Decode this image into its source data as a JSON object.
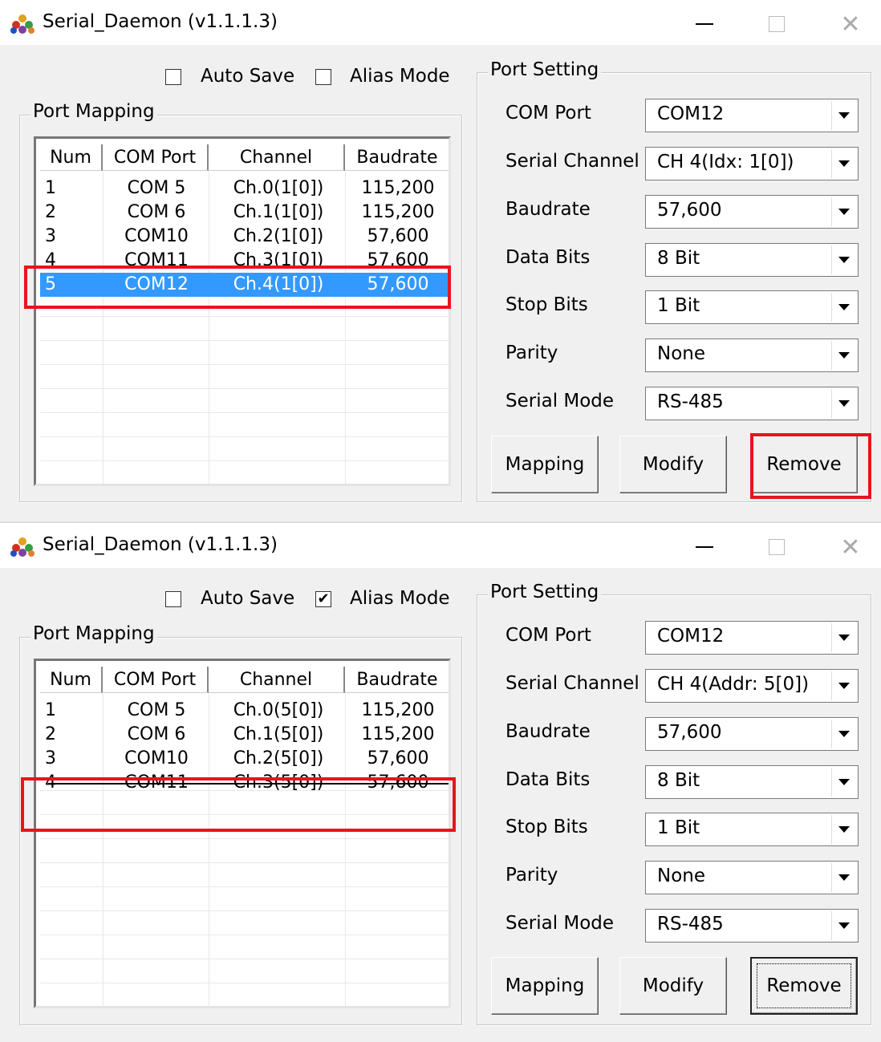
{
  "windows": [
    {
      "title": "Serial_Daemon (v1.1.1.3)",
      "auto_save": {
        "label": "Auto Save",
        "checked": false
      },
      "alias_mode": {
        "label": "Alias Mode",
        "checked": false
      },
      "port_mapping": {
        "title": "Port Mapping",
        "columns": [
          "Num",
          "COM Port",
          "Channel",
          "Baudrate"
        ],
        "rows": [
          {
            "num": "1",
            "com": "COM 5",
            "channel": "Ch.0(1[0])",
            "baud": "115,200"
          },
          {
            "num": "2",
            "com": "COM 6",
            "channel": "Ch.1(1[0])",
            "baud": "115,200"
          },
          {
            "num": "3",
            "com": "COM10",
            "channel": "Ch.2(1[0])",
            "baud": "57,600"
          },
          {
            "num": "4",
            "com": "COM11",
            "channel": "Ch.3(1[0])",
            "baud": "57,600"
          },
          {
            "num": "5",
            "com": "COM12",
            "channel": "Ch.4(1[0])",
            "baud": "57,600"
          }
        ]
      },
      "port_setting": {
        "title": "Port Setting",
        "fields": [
          {
            "label": "COM Port",
            "value": "COM12"
          },
          {
            "label": "Serial Channel",
            "value": "CH  4(Idx: 1[0])"
          },
          {
            "label": "Baudrate",
            "value": "57,600"
          },
          {
            "label": "Data Bits",
            "value": "8 Bit"
          },
          {
            "label": "Stop Bits",
            "value": "1 Bit"
          },
          {
            "label": "Parity",
            "value": "None"
          },
          {
            "label": "Serial Mode",
            "value": "RS-485"
          }
        ]
      },
      "buttons": {
        "mapping": "Mapping",
        "modify": "Modify",
        "remove": "Remove"
      }
    },
    {
      "title": "Serial_Daemon (v1.1.1.3)",
      "auto_save": {
        "label": "Auto Save",
        "checked": false
      },
      "alias_mode": {
        "label": "Alias Mode",
        "checked": true
      },
      "port_mapping": {
        "title": "Port Mapping",
        "columns": [
          "Num",
          "COM Port",
          "Channel",
          "Baudrate"
        ],
        "rows": [
          {
            "num": "1",
            "com": "COM 5",
            "channel": "Ch.0(5[0])",
            "baud": "115,200"
          },
          {
            "num": "2",
            "com": "COM 6",
            "channel": "Ch.1(5[0])",
            "baud": "115,200"
          },
          {
            "num": "3",
            "com": "COM10",
            "channel": "Ch.2(5[0])",
            "baud": "57,600"
          },
          {
            "num": "4",
            "com": "COM11",
            "channel": "Ch.3(5[0])",
            "baud": "57,600"
          }
        ]
      },
      "port_setting": {
        "title": "Port Setting",
        "fields": [
          {
            "label": "COM Port",
            "value": "COM12"
          },
          {
            "label": "Serial Channel",
            "value": "CH  4(Addr: 5[0])"
          },
          {
            "label": "Baudrate",
            "value": "57,600"
          },
          {
            "label": "Data Bits",
            "value": "8 Bit"
          },
          {
            "label": "Stop Bits",
            "value": "1 Bit"
          },
          {
            "label": "Parity",
            "value": "None"
          },
          {
            "label": "Serial Mode",
            "value": "RS-485"
          }
        ]
      },
      "buttons": {
        "mapping": "Mapping",
        "modify": "Modify",
        "remove": "Remove"
      }
    }
  ],
  "colors": {
    "selection": "#3399ff",
    "annotation": "#e8141c",
    "dialog_bg": "#f0f0f0"
  },
  "icons": [
    "app-icon",
    "minimize-icon",
    "maximize-icon",
    "close-icon",
    "dropdown-arrow-icon",
    "checkmark-icon"
  ]
}
